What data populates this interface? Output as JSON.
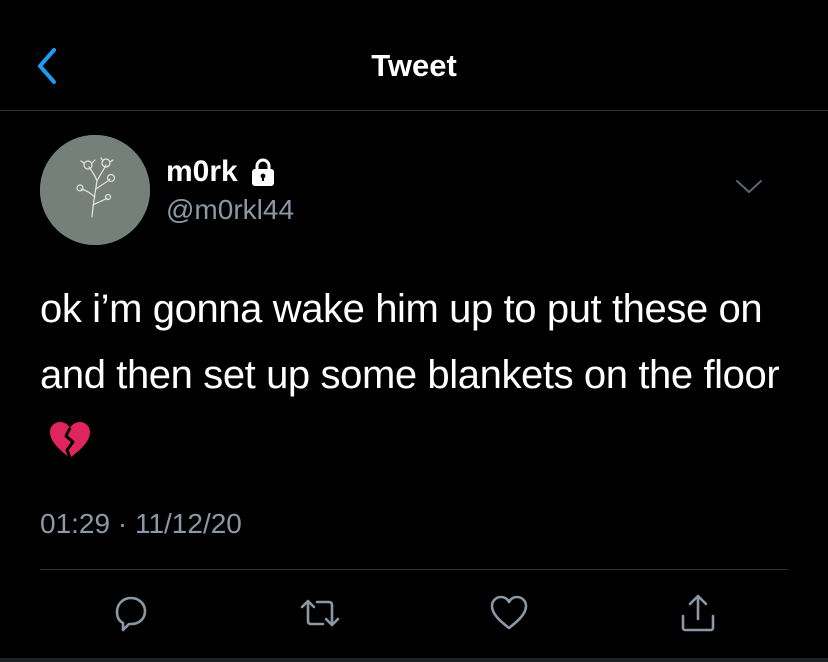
{
  "header": {
    "title": "Tweet",
    "back_icon": "chevron-left-icon"
  },
  "tweet": {
    "author": {
      "display_name": "m0rk",
      "handle": "@m0rkl44",
      "protected_icon": "lock-icon",
      "avatar": "flower-sketch-avatar"
    },
    "text": "ok i’m gonna wake him up to put these on and then set up some blankets on the floor",
    "emoji": "broken-heart-emoji",
    "timestamp": "01:29 · 11/12/20",
    "menu_icon": "chevron-down-icon"
  },
  "actions": [
    {
      "name": "reply",
      "icon": "reply-icon"
    },
    {
      "name": "retweet",
      "icon": "retweet-icon"
    },
    {
      "name": "like",
      "icon": "heart-icon"
    },
    {
      "name": "share",
      "icon": "share-icon"
    }
  ],
  "colors": {
    "background": "#000000",
    "accent": "#1d9bf0",
    "secondary_text": "#8b98a5",
    "divider": "#2f3336",
    "broken_heart": "#e0245e"
  }
}
